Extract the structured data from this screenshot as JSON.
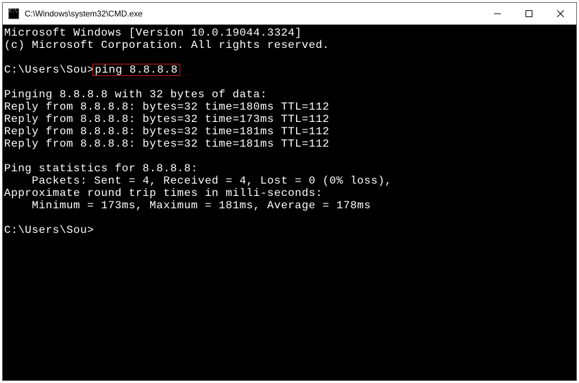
{
  "window": {
    "title": "C:\\Windows\\system32\\CMD.exe"
  },
  "console": {
    "header1": "Microsoft Windows [Version 10.0.19044.3324]",
    "header2": "(c) Microsoft Corporation. All rights reserved.",
    "prompt1_pre": "C:\\Users\\Sou>",
    "prompt1_cmd": "ping 8.8.8.8",
    "ping_header": "Pinging 8.8.8.8 with 32 bytes of data:",
    "replies": [
      "Reply from 8.8.8.8: bytes=32 time=180ms TTL=112",
      "Reply from 8.8.8.8: bytes=32 time=173ms TTL=112",
      "Reply from 8.8.8.8: bytes=32 time=181ms TTL=112",
      "Reply from 8.8.8.8: bytes=32 time=181ms TTL=112"
    ],
    "stats_header": "Ping statistics for 8.8.8.8:",
    "stats_packets": "    Packets: Sent = 4, Received = 4, Lost = 0 (0% loss),",
    "stats_rtt_header": "Approximate round trip times in milli-seconds:",
    "stats_rtt": "    Minimum = 173ms, Maximum = 181ms, Average = 178ms",
    "prompt2": "C:\\Users\\Sou>"
  }
}
